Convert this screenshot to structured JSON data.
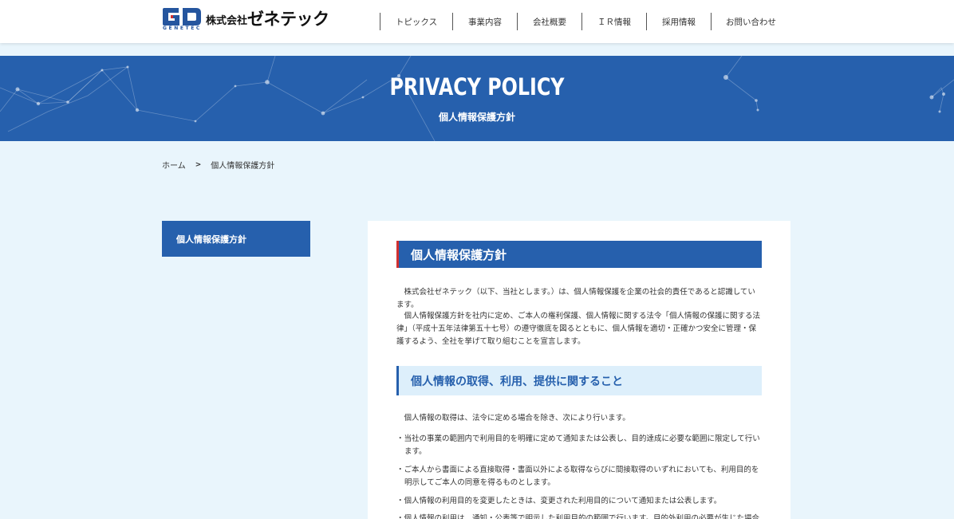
{
  "header": {
    "logo_sub": "GENETEC",
    "company_prefix": "株式会社",
    "company_name": "ゼネテック",
    "nav": [
      {
        "label": "トピックス"
      },
      {
        "label": "事業内容"
      },
      {
        "label": "会社概要"
      },
      {
        "label": "ＩＲ情報"
      },
      {
        "label": "採用情報"
      },
      {
        "label": "お問い合わせ"
      }
    ]
  },
  "banner": {
    "title": "PRIVACY POLICY",
    "subtitle": "個人情報保護方針"
  },
  "breadcrumb": {
    "home": "ホーム",
    "separator": ">",
    "current": "個人情報保護方針"
  },
  "sidebar": {
    "items": [
      {
        "label": "個人情報保護方針"
      }
    ]
  },
  "content": {
    "heading": "個人情報保護方針",
    "intro_1": "　株式会社ゼネテック（以下、当社とします。）は、個人情報保護を企業の社会的責任であると認識しています。",
    "intro_2": "　個人情報保護方針を社内に定め、ご本人の権利保護、個人情報に関する法令「個人情報の保護に関する法律」（平成十五年法律第五十七号）の遵守徹底を図るとともに、個人情報を適切・正確かつ安全に管理・保護するよう、全社を挙げて取り組むことを宣言します。",
    "section_heading": "個人情報の取得、利用、提供に関すること",
    "section_intro": "　個人情報の取得は、法令に定める場合を除き、次により行います。",
    "bullets": [
      "・当社の事業の範囲内で利用目的を明確に定めて通知または公表し、目的達成に必要な範囲に限定して行います。",
      "・ご本人から書面による直接取得・書面以外による取得ならびに間接取得のいずれにおいても、利用目的を明示してご本人の同意を得るものとします。",
      "・個人情報の利用目的を変更したときは、変更された利用目的について通知または公表します。",
      "・個人情報の利用は、通知・公表等で明示した利用目的の範囲で行います。目的外利用の必要が生じた場合は"
    ]
  },
  "colors": {
    "primary": "#2660ad",
    "accent_red": "#d03030",
    "page_bg": "#e9f5fc",
    "section_bg": "#ddeffb"
  }
}
